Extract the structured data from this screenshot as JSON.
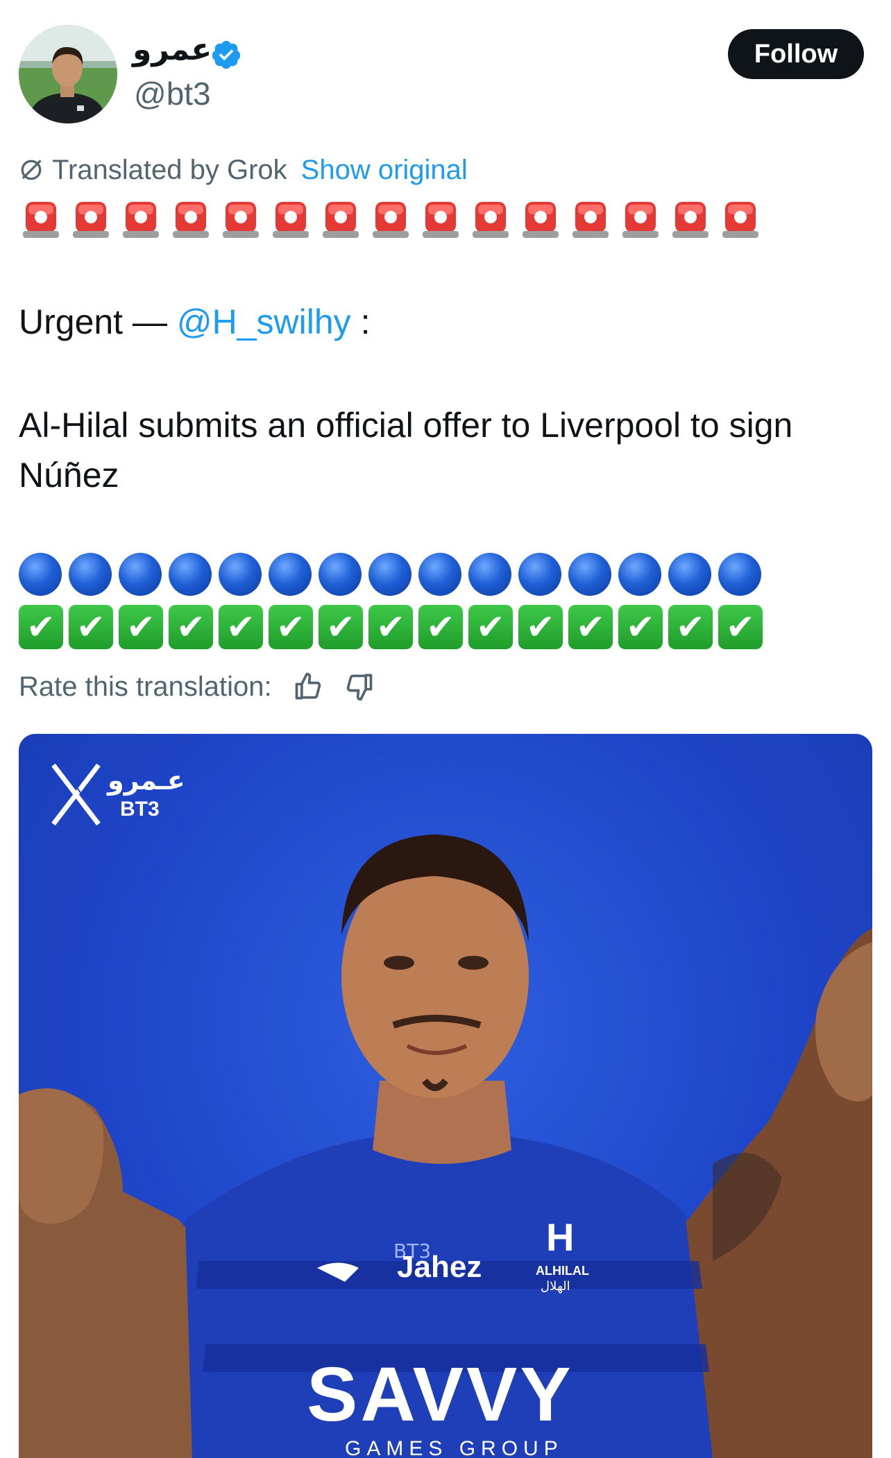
{
  "author": {
    "display_name": "عمرو",
    "handle": "@bt3",
    "verified": true,
    "avatar_icon": "profile-photo"
  },
  "follow_label": "Follow",
  "translation": {
    "label": "Translated by Grok",
    "show_original": "Show original",
    "rate_label": "Rate this translation:"
  },
  "post": {
    "siren_count": 15,
    "urgent_prefix": "Urgent —",
    "mention": "@H_swilhy",
    "urgent_suffix": ":",
    "body": "Al-Hilal submits an official offer to Liverpool to sign Núñez",
    "blue_circle_count": 15,
    "check_count": 15
  },
  "media": {
    "watermark_arabic": "عـمرو",
    "watermark_latin": "BT3",
    "jersey_sponsor": "SAVVY",
    "jersey_sponsor_sub": "GAMES GROUP",
    "jersey_brand": "Jahez",
    "club_badge_text": "ALHILAL",
    "club_badge_arabic": "الهلال"
  },
  "colors": {
    "accent": "#1d9bf0",
    "follow_bg": "#0f1419",
    "muted": "#536471",
    "media_bg": "#1f46c9"
  }
}
